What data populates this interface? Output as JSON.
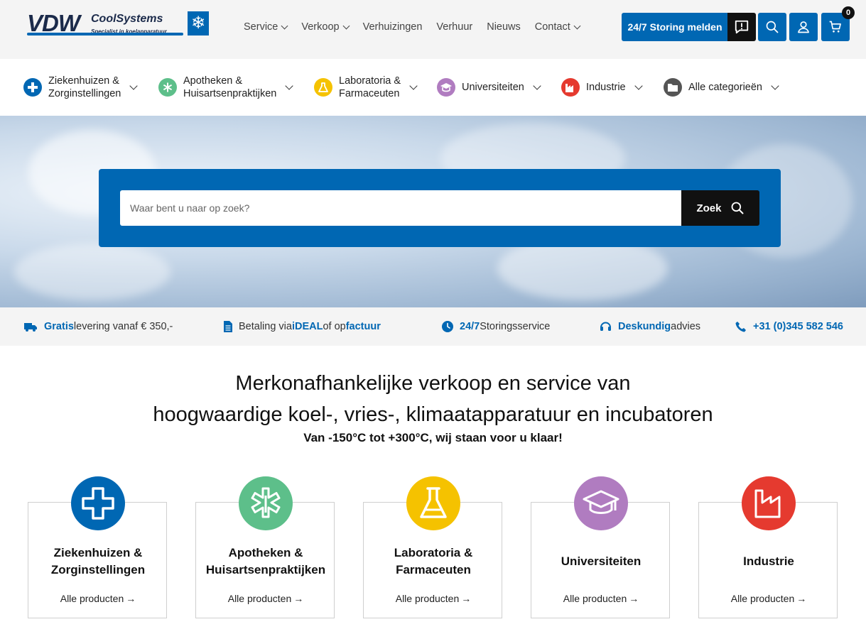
{
  "brand": {
    "logo_vdw": "VDW",
    "logo_cool": "CoolSystems",
    "logo_tagline": "Specialist in koelapparatuur"
  },
  "nav": {
    "items": [
      {
        "label": "Service",
        "dropdown": true
      },
      {
        "label": "Verkoop",
        "dropdown": true
      },
      {
        "label": "Verhuizingen",
        "dropdown": false
      },
      {
        "label": "Verhuur",
        "dropdown": false
      },
      {
        "label": "Nieuws",
        "dropdown": false
      },
      {
        "label": "Contact",
        "dropdown": true
      }
    ]
  },
  "header_actions": {
    "storing_label": "24/7 Storing melden",
    "cart_count": "0",
    "icons": [
      "alert-message-icon",
      "search-icon",
      "user-icon",
      "cart-icon"
    ]
  },
  "categories": [
    {
      "line1": "Ziekenhuizen &",
      "line2": "Zorginstellingen",
      "color": "#0067b3",
      "icon": "medical-cross-icon"
    },
    {
      "line1": "Apotheken &",
      "line2": "Huisartsenpraktijken",
      "color": "#5dbf8a",
      "icon": "star-of-life-icon"
    },
    {
      "line1": "Laboratoria &",
      "line2": "Farmaceuten",
      "color": "#f5c200",
      "icon": "flask-icon"
    },
    {
      "line1": "Universiteiten",
      "line2": "",
      "color": "#b07cc0",
      "icon": "graduation-cap-icon"
    },
    {
      "line1": "Industrie",
      "line2": "",
      "color": "#e53a2f",
      "icon": "factory-icon"
    },
    {
      "line1": "Alle categorieën",
      "line2": "",
      "color": "#555555",
      "icon": "folder-icon"
    }
  ],
  "search": {
    "placeholder": "Waar bent u naar op zoek?",
    "button_label": "Zoek"
  },
  "usps": [
    {
      "bold": "Gratis",
      "rest": " levering vanaf € 350,-",
      "icon": "truck-icon"
    },
    {
      "pre": "Betaling via ",
      "bold": "iDEAL",
      "mid": " of op ",
      "bold2": "factuur",
      "icon": "invoice-icon"
    },
    {
      "bold": "24/7",
      "rest": " Storingsservice",
      "icon": "clock-icon"
    },
    {
      "bold": "Deskundig",
      "rest": " advies",
      "icon": "headset-icon"
    },
    {
      "bold": "+31 (0)345 582 546",
      "rest": "",
      "icon": "phone-icon"
    }
  ],
  "headline": {
    "line1": "Merkonafhankelijke verkoop en service van",
    "line2": "hoogwaardige koel-, vries-, klimaatapparatuur en incubatoren",
    "sub": "Van -150°C tot +300°C, wij staan voor u klaar!"
  },
  "cards": [
    {
      "line1": "Ziekenhuizen &",
      "line2": "Zorginstellingen",
      "link": "Alle producten",
      "color": "#0067b3"
    },
    {
      "line1": "Apotheken &",
      "line2": "Huisartsenpraktijken",
      "link": "Alle producten",
      "color": "#5dbf8a"
    },
    {
      "line1": "Laboratoria &",
      "line2": "Farmaceuten",
      "link": "Alle producten",
      "color": "#f5c200"
    },
    {
      "line1": "Universiteiten",
      "line2": "",
      "link": "Alle producten",
      "color": "#b07cc0"
    },
    {
      "line1": "Industrie",
      "line2": "",
      "link": "Alle producten",
      "color": "#e53a2f"
    }
  ]
}
